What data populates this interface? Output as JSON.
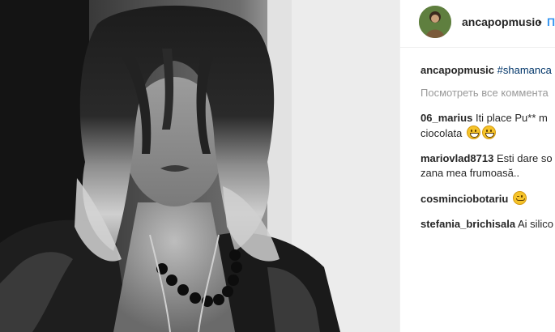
{
  "post": {
    "username": "ancapopmusic",
    "follow_separator": "•",
    "follow_label": "П",
    "caption": {
      "user": "ancapopmusic",
      "hashtag": "#shamanca"
    },
    "view_all_comments": "Посмотреть все коммента",
    "comments": [
      {
        "user": "06_marius",
        "text_line1": "Iti place Pu** m",
        "text_line2": "ciocolata",
        "emoji": [
          "grinning-face-emoji",
          "grinning-face-emoji"
        ]
      },
      {
        "user": "mariovlad8713",
        "text_line1": "Esti dare so",
        "text_line2": "zana mea frumoasă..",
        "emoji": []
      },
      {
        "user": "cosminciobotariu",
        "text_line1": "",
        "text_line2": "",
        "emoji": [
          "winking-face-emoji"
        ]
      },
      {
        "user": "stefania_brichisala",
        "text_line1": "Ai silico",
        "text_line2": "",
        "emoji": []
      }
    ]
  },
  "colors": {
    "link_blue": "#3897f0",
    "hashtag": "#003569",
    "muted": "#999999",
    "text": "#262626"
  },
  "photo": {
    "description_icon": "black-and-white-portrait-image"
  }
}
